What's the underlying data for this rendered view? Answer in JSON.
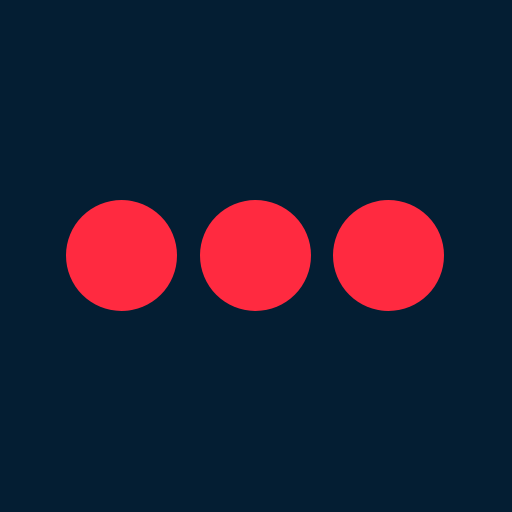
{
  "icon": {
    "name": "more-horizontal-icon",
    "background_color": "#041e33",
    "dot_color": "#ff2a40",
    "dot_count": 3
  }
}
